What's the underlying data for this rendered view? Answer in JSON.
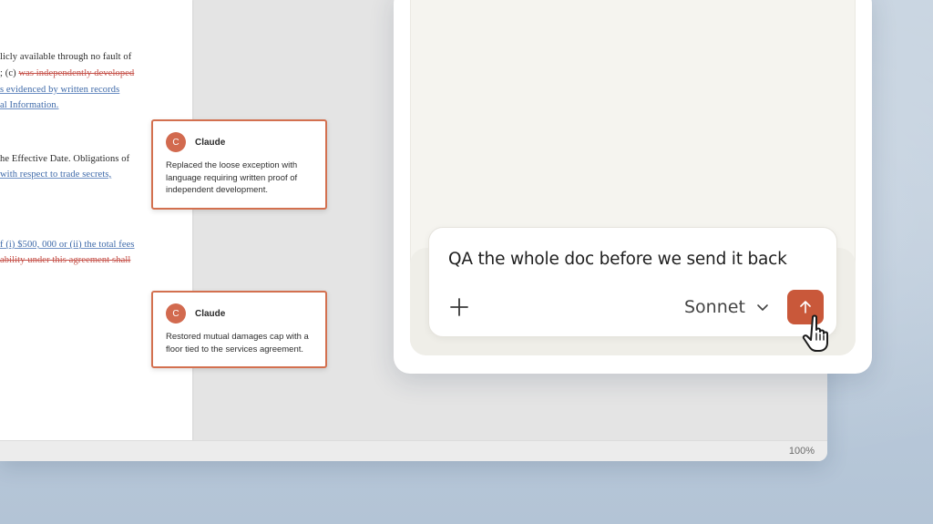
{
  "document": {
    "lines": [
      [
        {
          "t": "licly available through no fault of",
          "k": "plain"
        }
      ],
      [
        {
          "t": "; (c) ",
          "k": "plain"
        },
        {
          "t": "was independently developed",
          "k": "del"
        }
      ],
      [
        {
          "t": "s evidenced by written records",
          "k": "ins"
        }
      ],
      [
        {
          "t": "al Information.",
          "k": "ins"
        }
      ],
      [
        {
          "t": "he Effective Date. Obligations of",
          "k": "plain"
        }
      ],
      [
        {
          "t": " with respect to trade secrets,",
          "k": "ins"
        }
      ],
      [
        {
          "t": "f (i) $500, 000 or (ii) the total fees",
          "k": "ins"
        }
      ],
      [
        {
          "t": "ability under this agreement shall",
          "k": "del"
        }
      ]
    ]
  },
  "comments": [
    {
      "avatar": "C",
      "author": "Claude",
      "body": "Replaced the loose exception with language requiring written proof of independent development."
    },
    {
      "avatar": "C",
      "author": "Claude",
      "body": "Restored mutual damages cap with a floor tied to the services agreement."
    }
  ],
  "statusbar": {
    "zoom": "100%"
  },
  "composer": {
    "prompt_text": "QA the whole doc before we send it back",
    "model": "Sonnet"
  },
  "icons": {
    "plus": "plus-icon",
    "chevron": "chevron-down-icon",
    "send": "arrow-up-icon",
    "cursor": "hand-pointer-icon"
  },
  "colors": {
    "accent": "#c9583a",
    "comment_border": "#d3704f",
    "insertion": "#3c68a8",
    "deletion": "#c5524a"
  }
}
